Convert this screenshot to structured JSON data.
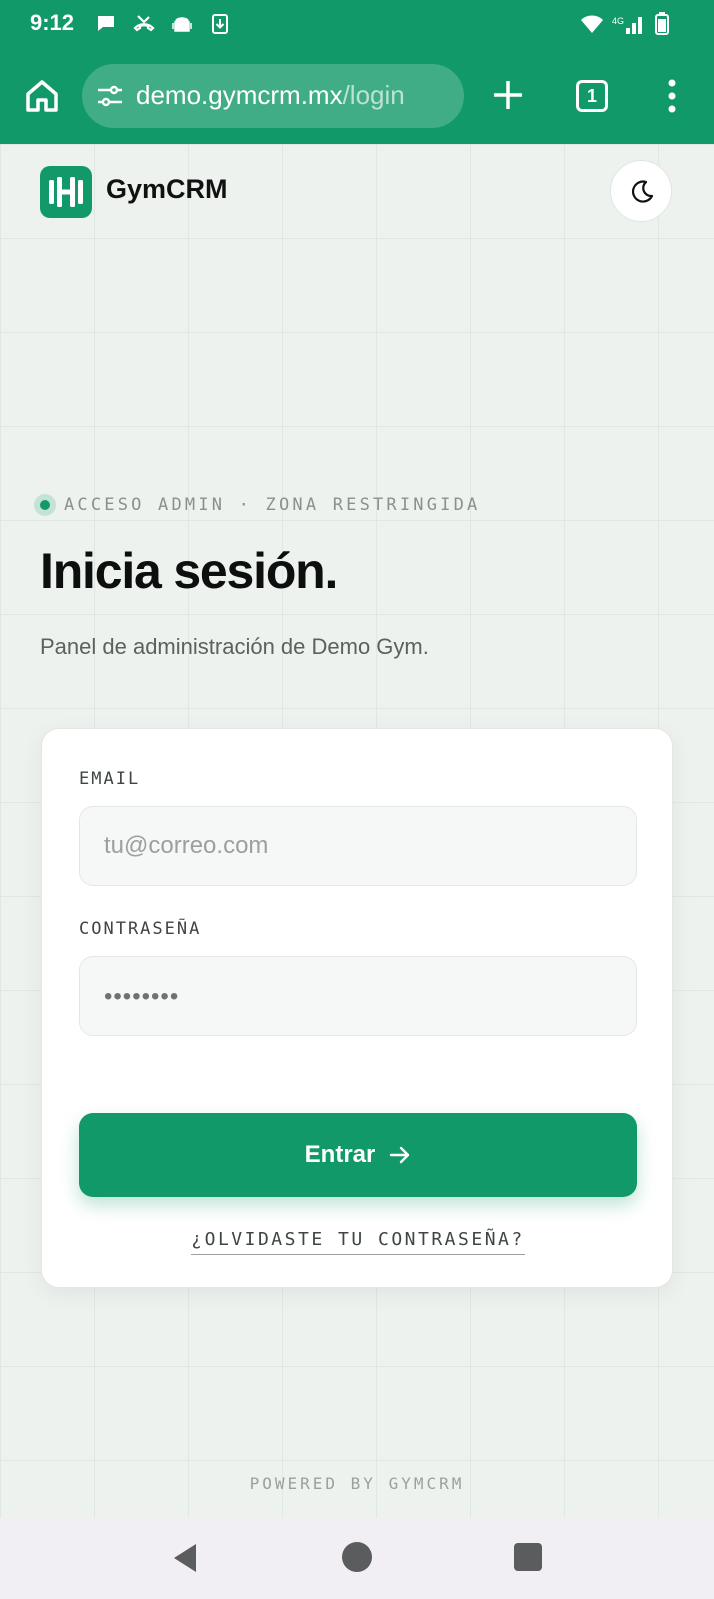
{
  "status_bar": {
    "time": "9:12",
    "left_icons": [
      "chat-bubble-icon",
      "missed-call-icon",
      "android-icon",
      "download-icon"
    ],
    "right_icons": [
      "wifi-icon",
      "4g-signal-icon",
      "battery-icon"
    ]
  },
  "browser": {
    "url_host": "demo.gymcrm.mx",
    "url_path": "/login",
    "tab_count": "1"
  },
  "header": {
    "brand": "GymCRM"
  },
  "login": {
    "eyebrow": "ACCESO ADMIN · ZONA RESTRINGIDA",
    "headline": "Inicia sesión.",
    "subtitle": "Panel de administración de Demo Gym.",
    "email_label": "EMAIL",
    "email_placeholder": "tu@correo.com",
    "password_label": "CONTRASEÑA",
    "password_placeholder": "••••••••",
    "submit_label": "Entrar",
    "forgot_label": "¿OLVIDASTE TU CONTRASEÑA?"
  },
  "footer": {
    "powered": "POWERED BY GYMCRM"
  },
  "colors": {
    "brand_green": "#12996a",
    "page_bg": "#edf2ef"
  }
}
